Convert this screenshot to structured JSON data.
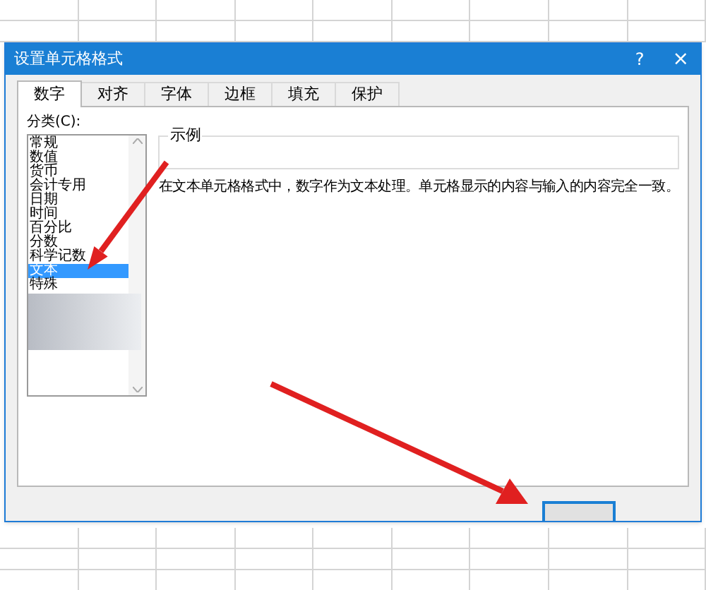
{
  "window": {
    "title": "设置单元格格式",
    "help": "?",
    "close": "×"
  },
  "tabs": [
    {
      "label": "数字",
      "selected": true
    },
    {
      "label": "对齐",
      "selected": false
    },
    {
      "label": "字体",
      "selected": false
    },
    {
      "label": "边框",
      "selected": false
    },
    {
      "label": "填充",
      "selected": false
    },
    {
      "label": "保护",
      "selected": false
    }
  ],
  "category": {
    "label": "分类(C):",
    "items": [
      {
        "label": "常规",
        "selected": false
      },
      {
        "label": "数值",
        "selected": false
      },
      {
        "label": "货币",
        "selected": false
      },
      {
        "label": "会计专用",
        "selected": false
      },
      {
        "label": "日期",
        "selected": false
      },
      {
        "label": "时间",
        "selected": false
      },
      {
        "label": "百分比",
        "selected": false
      },
      {
        "label": "分数",
        "selected": false
      },
      {
        "label": "科学记数",
        "selected": false
      },
      {
        "label": "文本",
        "selected": true
      },
      {
        "label": "特殊",
        "selected": false
      }
    ]
  },
  "sample": {
    "label": "示例"
  },
  "description": "在文本单元格格式中，数字作为文本处理。单元格显示的内容与输入的内容完全一致。"
}
